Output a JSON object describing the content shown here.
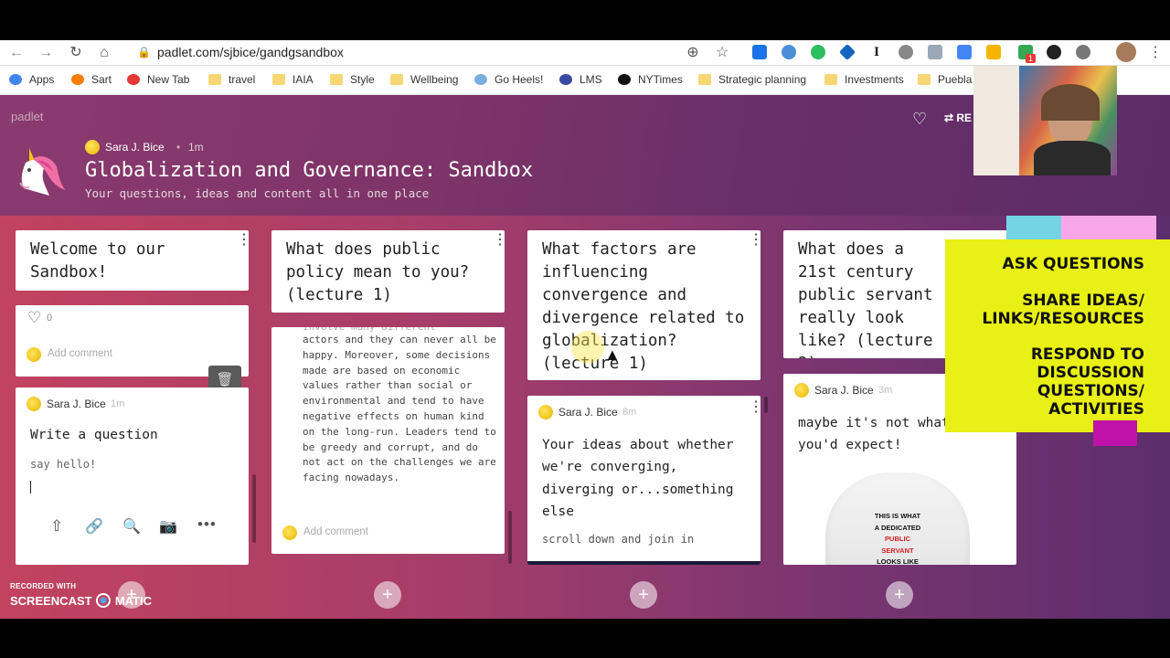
{
  "browser": {
    "url": "padlet.com/sjbice/gandgsandbox",
    "ext_badge": "1",
    "bookmarks": [
      {
        "label": "Apps",
        "icon": "apps-grid-icon"
      },
      {
        "label": "Sart",
        "icon": "blogger-icon"
      },
      {
        "label": "New Tab",
        "icon": "newtab-icon"
      },
      {
        "label": "travel",
        "icon": "folder-icon"
      },
      {
        "label": "IAIA",
        "icon": "folder-icon"
      },
      {
        "label": "Style",
        "icon": "folder-icon"
      },
      {
        "label": "Wellbeing",
        "icon": "folder-icon"
      },
      {
        "label": "Go Heels!",
        "icon": "globe-icon"
      },
      {
        "label": "LMS",
        "icon": "lms-icon"
      },
      {
        "label": "NYTimes",
        "icon": "nytimes-icon"
      },
      {
        "label": "Strategic planning",
        "icon": "folder-icon"
      },
      {
        "label": "Investments",
        "icon": "folder-icon"
      },
      {
        "label": "Puebla",
        "icon": "folder-icon"
      }
    ]
  },
  "padlet": {
    "brand": "padlet",
    "author": "Sara J. Bice",
    "time": "1m",
    "title": "Globalization and Governance: Sandbox",
    "subtitle": "Your questions, ideas and content all in one place",
    "remake_label": "RE"
  },
  "columns": [
    {
      "title": "Welcome to our Sandbox!",
      "likes": "0",
      "add_comment": "Add comment",
      "compose": {
        "author": "Sara J. Bice",
        "time": "1m",
        "subject": "Write a question",
        "body": "say hello!"
      }
    },
    {
      "title": "What does public policy mean to you? (lecture 1)",
      "post_partial_top": "involve many different",
      "post_body": "actors and they can never all be happy. Moreover, some decisions made are based on economic values rather than social or environmental and tend to have negative effects on human kind on the long-run. Leaders tend to be greedy and corrupt, and do not act on the challenges we are facing nowadays.",
      "add_comment": "Add comment"
    },
    {
      "title": "What factors are influencing convergence and divergence related to globalization? (lecture 1)",
      "post": {
        "author": "Sara J. Bice",
        "time": "8m",
        "subject": "Your ideas about whether we're converging, diverging or...something else",
        "body": "scroll down and join in"
      }
    },
    {
      "title": "What does a 21st century public servant really look like? (lecture 2)",
      "post": {
        "author": "Sara J. Bice",
        "time": "3m",
        "body": "maybe it's not what you'd expect!",
        "image_text": [
          "THIS IS WHAT",
          "A DEDICATED",
          "PUBLIC",
          "SERVANT",
          "LOOKS LIKE"
        ]
      }
    }
  ],
  "sticky_note": {
    "lines": [
      "ASK QUESTIONS",
      "SHARE IDEAS/",
      "LINKS/RESOURCES",
      "RESPOND TO",
      "DISCUSSION",
      "QUESTIONS/",
      "ACTIVITIES"
    ]
  },
  "watermark": {
    "top": "RECORDED WITH",
    "brand": "SCREENCAST",
    "suffix": "MATIC"
  },
  "colors": {
    "sticky": "#e8f016",
    "author_dot": "#f5c800",
    "padlet_bg": "#8a3a6e"
  }
}
